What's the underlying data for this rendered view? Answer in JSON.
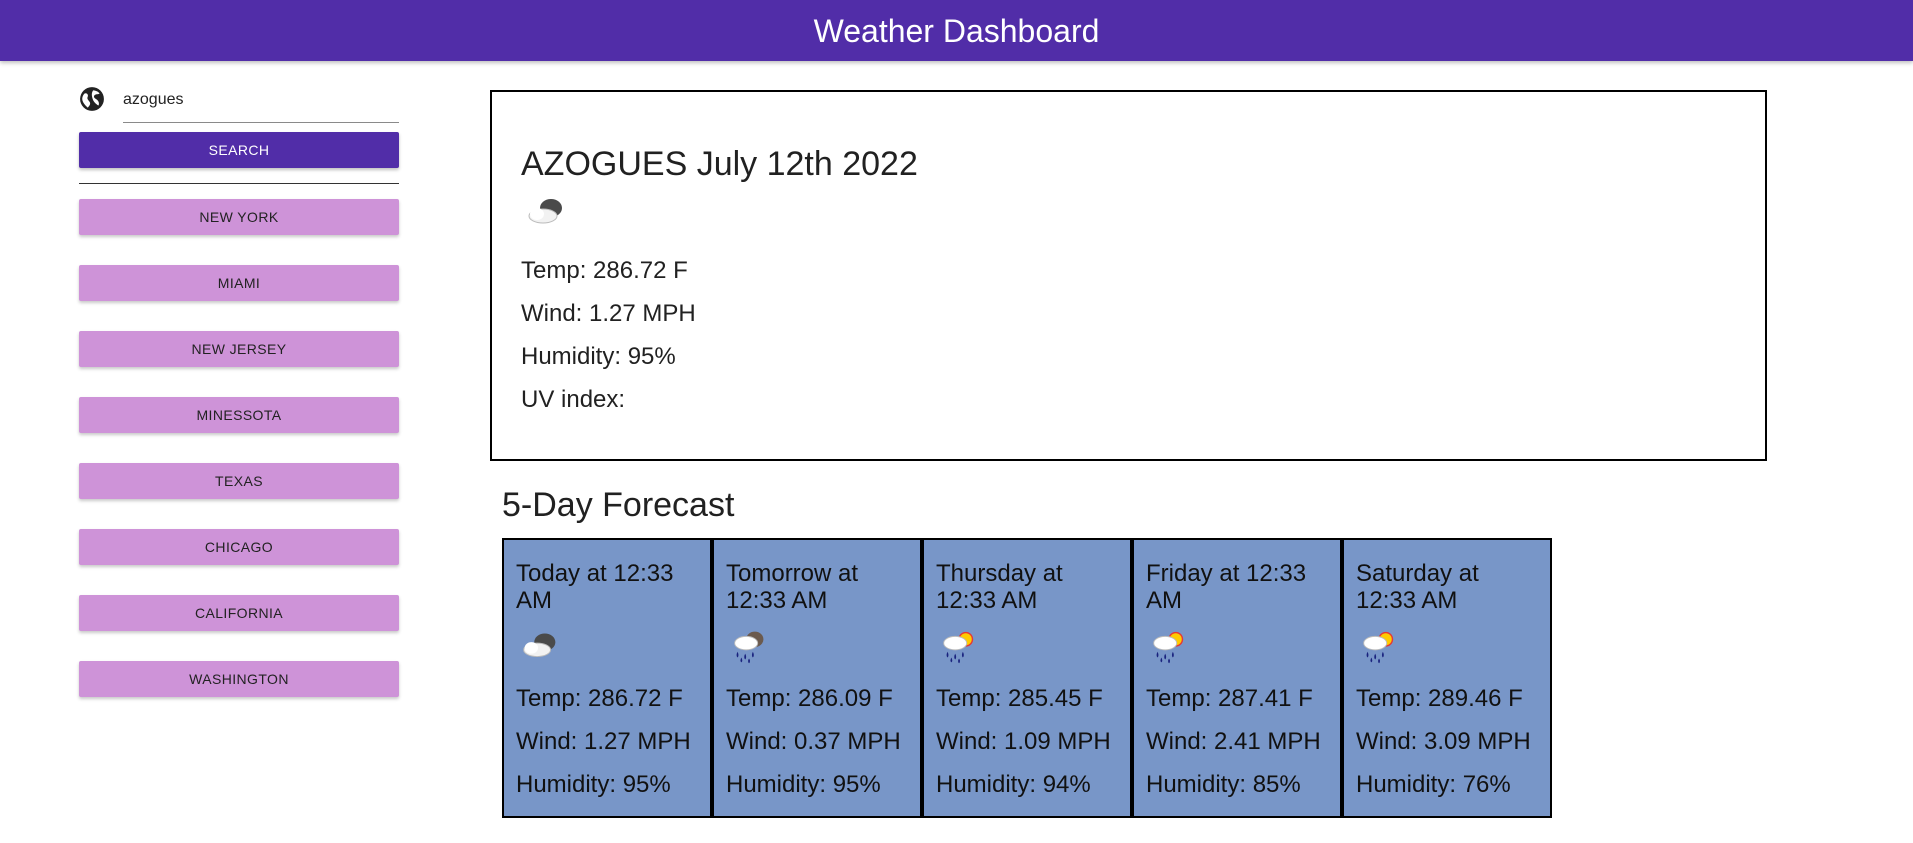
{
  "header": {
    "title": "Weather Dashboard"
  },
  "search": {
    "value": "azogues",
    "button_label": "SEARCH"
  },
  "cities": [
    "NEW YORK",
    "MIAMI",
    "NEW JERSEY",
    "MINESSOTA",
    "TEXAS",
    "CHICAGO",
    "CALIFORNIA",
    "WASHINGTON"
  ],
  "current": {
    "title": "AZOGUES July 12th 2022",
    "icon": "cloud-icon",
    "temp": "Temp: 286.72 F",
    "wind": "Wind: 1.27 MPH",
    "humidity": "Humidity: 95%",
    "uv": "UV index:"
  },
  "forecast": {
    "title": "5-Day Forecast",
    "days": [
      {
        "date": "Today at 12:33 AM",
        "icon": "cloud-icon",
        "temp": "Temp: 286.72 F",
        "wind": "Wind: 1.27 MPH",
        "humidity": "Humidity: 95%"
      },
      {
        "date": "Tomorrow at 12:33 AM",
        "icon": "rain-cloud-icon",
        "temp": "Temp: 286.09 F",
        "wind": "Wind: 0.37 MPH",
        "humidity": "Humidity: 95%"
      },
      {
        "date": "Thursday at 12:33 AM",
        "icon": "sun-rain-icon",
        "temp": "Temp: 285.45 F",
        "wind": "Wind: 1.09 MPH",
        "humidity": "Humidity: 94%"
      },
      {
        "date": "Friday at 12:33 AM",
        "icon": "sun-rain-icon",
        "temp": "Temp: 287.41 F",
        "wind": "Wind: 2.41 MPH",
        "humidity": "Humidity: 85%"
      },
      {
        "date": "Saturday at 12:33 AM",
        "icon": "sun-rain-icon",
        "temp": "Temp: 289.46 F",
        "wind": "Wind: 3.09 MPH",
        "humidity": "Humidity: 76%"
      }
    ]
  },
  "colors": {
    "header": "#512da8",
    "search_button": "#512da8",
    "city_button": "#ce93d8",
    "forecast_card": "#7896c8"
  }
}
